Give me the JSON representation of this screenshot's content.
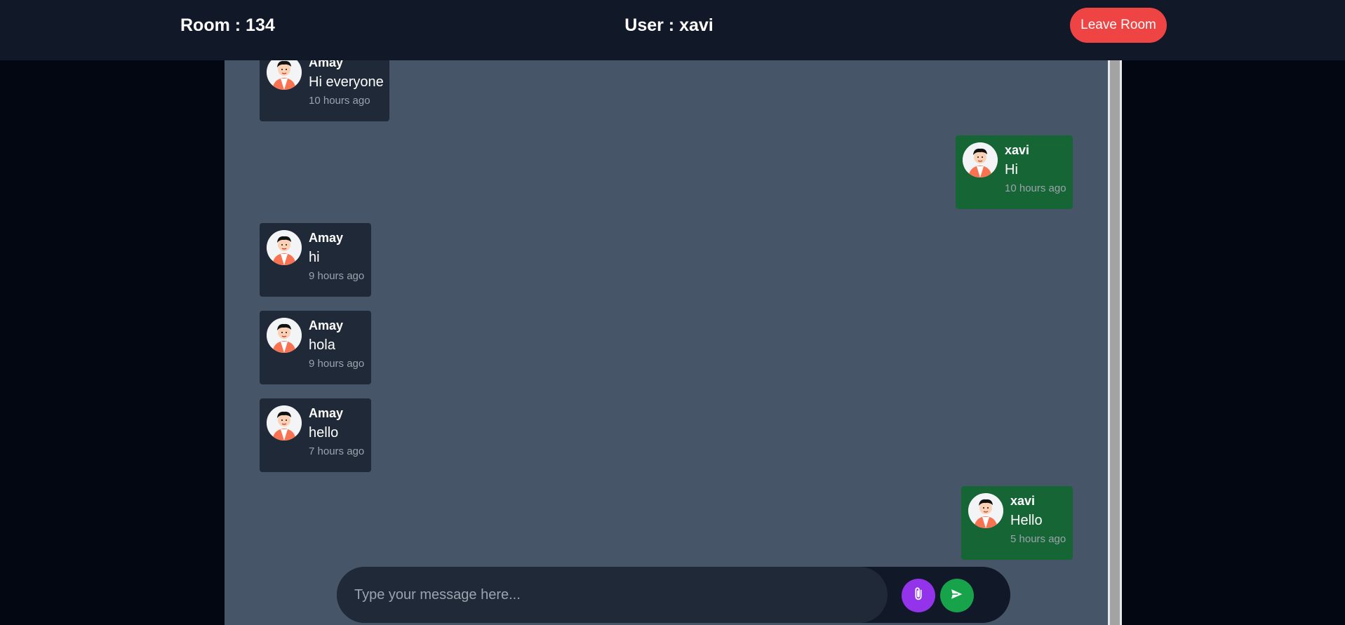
{
  "header": {
    "room_label": "Room : 134",
    "user_label": "User : xavi",
    "leave_button": "Leave Room"
  },
  "messages": [
    {
      "sender": "Amay",
      "text": "Hi everyone",
      "time": "10 hours ago",
      "own": false
    },
    {
      "sender": "xavi",
      "text": "Hi",
      "time": "10 hours ago",
      "own": true
    },
    {
      "sender": "Amay",
      "text": "hi",
      "time": "9 hours ago",
      "own": false
    },
    {
      "sender": "Amay",
      "text": "hola",
      "time": "9 hours ago",
      "own": false
    },
    {
      "sender": "Amay",
      "text": "hello",
      "time": "7 hours ago",
      "own": false
    },
    {
      "sender": "xavi",
      "text": "Hello",
      "time": "5 hours ago",
      "own": true
    }
  ],
  "composer": {
    "placeholder": "Type your message here...",
    "value": ""
  },
  "icons": {
    "attach": "paperclip-icon",
    "send": "send-icon"
  },
  "colors": {
    "topbar": "#111827",
    "chat_background": "#475569",
    "other_bubble": "#1f2937",
    "own_bubble": "#166534",
    "leave_button": "#ef4444",
    "attach_button": "#9333ea",
    "send_button": "#16a34a"
  }
}
